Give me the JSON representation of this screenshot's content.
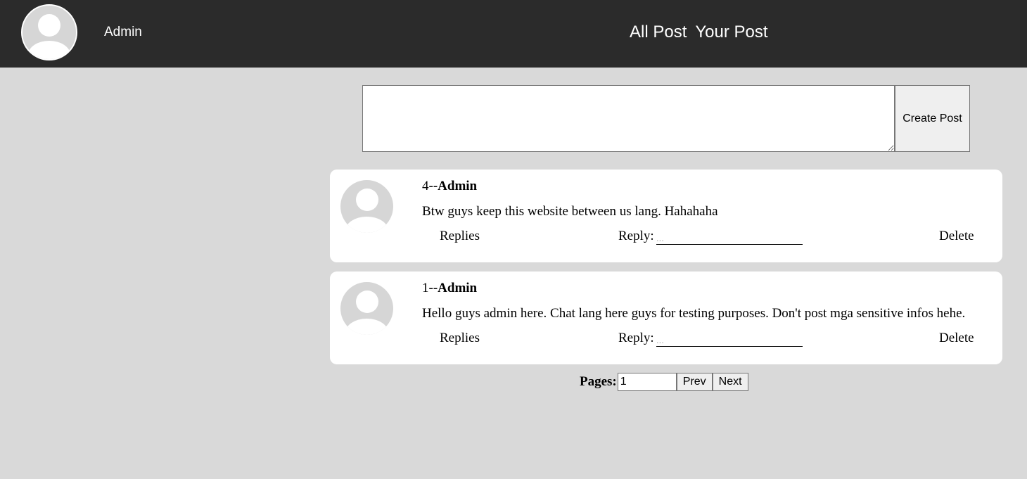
{
  "header": {
    "username": "Admin",
    "nav": [
      "All Post",
      "Your Post"
    ]
  },
  "composer": {
    "textarea_value": "",
    "create_label": "Create Post"
  },
  "posts": [
    {
      "id": "4",
      "separator": "--",
      "author": "Admin",
      "text": "Btw guys keep this website between us lang. Hahahaha",
      "replies_label": "Replies",
      "reply_label": "Reply:",
      "reply_placeholder": "...",
      "delete_label": "Delete"
    },
    {
      "id": "1",
      "separator": "--",
      "author": "Admin",
      "text": "Hello guys admin here. Chat lang here guys for testing purposes. Don't post mga sensitive infos hehe.",
      "replies_label": "Replies",
      "reply_label": "Reply:",
      "reply_placeholder": "...",
      "delete_label": "Delete"
    }
  ],
  "pagination": {
    "label": "Pages:",
    "current_page": "1",
    "prev_label": "Prev",
    "next_label": "Next"
  }
}
